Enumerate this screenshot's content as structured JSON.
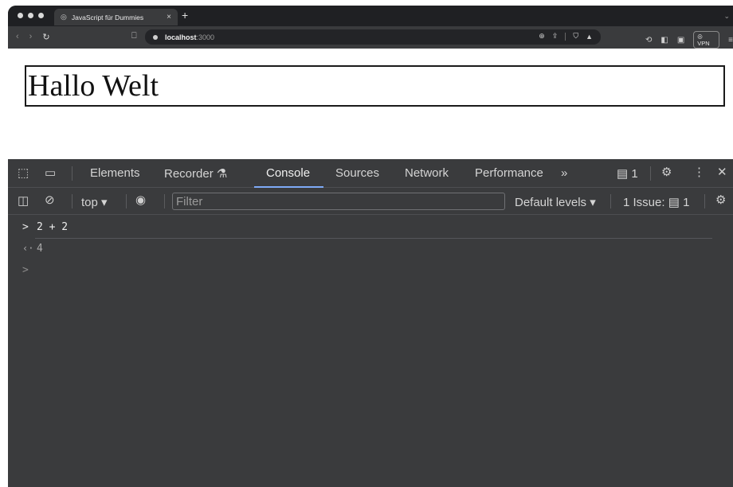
{
  "browser": {
    "tab": {
      "title": "JavaScript für Dummies",
      "close": "×"
    },
    "new_tab": "+",
    "nav": {
      "back": "‹",
      "forward": "›",
      "reload": "↻"
    },
    "url": {
      "host": "localhost",
      "port": ":3000"
    },
    "vpn_label": "VPN"
  },
  "page": {
    "heading": "Hallo Welt"
  },
  "devtools": {
    "tabs": [
      "Elements",
      "Recorder",
      "Console",
      "Sources",
      "Network",
      "Performance"
    ],
    "active_tab": "Console",
    "more": "»",
    "message_count": "1",
    "context": "top",
    "filter_placeholder": "Filter",
    "levels": "Default levels",
    "issues_label": "1 Issue:",
    "issues_count": "1",
    "console": {
      "input": "2 + 2",
      "result": "4",
      "input_prompt": ">",
      "result_prompt": "‹·",
      "empty_prompt": ">"
    }
  },
  "colors": {
    "accent": "#7eaaf7",
    "devtools_bg": "#3a3b3d",
    "tabstrip_bg": "#1f2023"
  }
}
